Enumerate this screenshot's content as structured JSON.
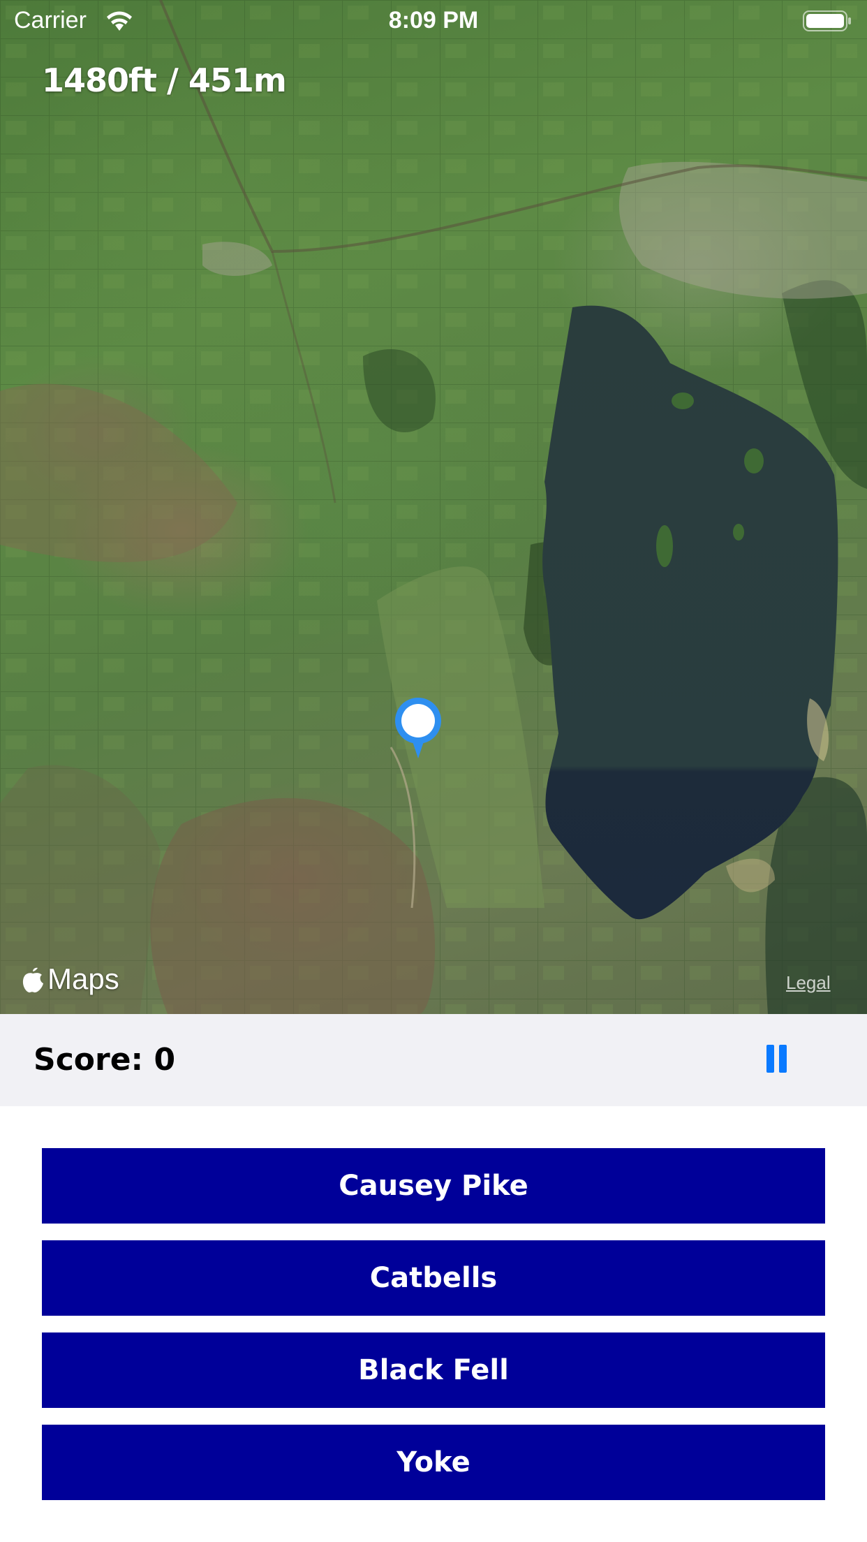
{
  "status_bar": {
    "carrier": "Carrier",
    "time": "8:09 PM"
  },
  "map": {
    "elevation": "1480ft / 451m",
    "attribution": "Maps",
    "legal": "Legal"
  },
  "score_bar": {
    "score_text": "Score: 0"
  },
  "answers": [
    {
      "label": "Causey Pike"
    },
    {
      "label": "Catbells"
    },
    {
      "label": "Black Fell"
    },
    {
      "label": "Yoke"
    }
  ],
  "colors": {
    "answer_button": "#000099",
    "pause_accent": "#0a7aff",
    "score_bar_bg": "#f1f1f5",
    "pin": "#2e8ff0"
  }
}
